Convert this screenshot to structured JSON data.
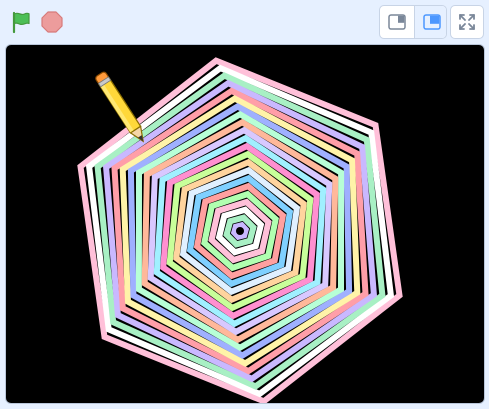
{
  "toolbar": {
    "green_flag_icon": "green-flag-icon",
    "stop_icon": "stop-sign-icon",
    "small_stage_icon": "small-stage-layout-icon",
    "normal_stage_icon": "normal-stage-layout-icon",
    "fullscreen_icon": "fullscreen-icon"
  },
  "colors": {
    "toolbar_bg": "#e6f0ff",
    "flag_green": "#4cbf56",
    "stop_red": "#ec9c9c",
    "accent_blue": "#4c97ff",
    "stage_bg": "#000000"
  },
  "stage": {
    "sprite": "pencil",
    "drawing": "hexagonal-spiral",
    "stroke_palette": [
      "#ffc0d9",
      "#ffffff",
      "#a8f0c4",
      "#c9b8ff",
      "#ff9ea8",
      "#fff3a8",
      "#9fb0ff",
      "#b7ffd6",
      "#ffb89a",
      "#d8c8ff",
      "#a0f0ff",
      "#ff8fd0",
      "#c8ff9a",
      "#ffd49e",
      "#e0f0ff",
      "#7fd0ff",
      "#ffa0a0",
      "#b0ffb0"
    ]
  }
}
